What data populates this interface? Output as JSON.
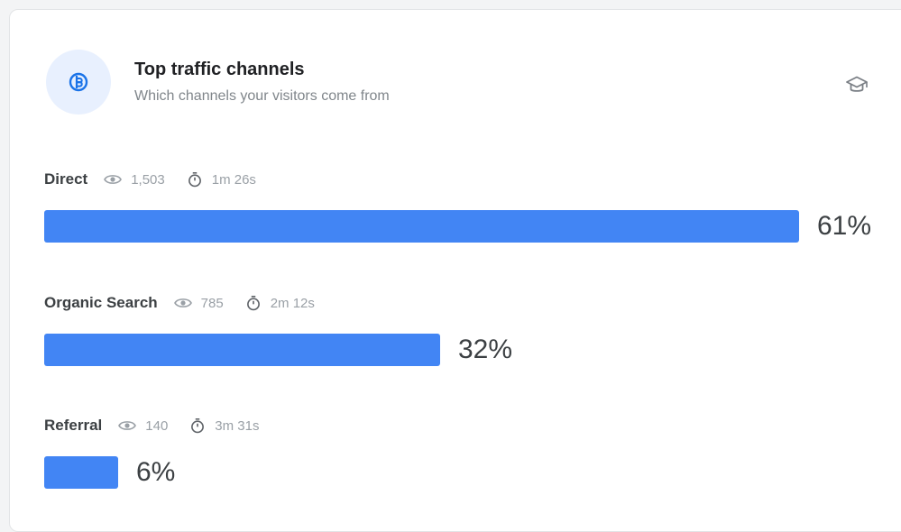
{
  "widget": {
    "title": "Top traffic channels",
    "subtitle": "Which channels your visitors come from",
    "header_icon": "channels-icon",
    "learn_icon": "graduation-cap-icon",
    "accent_color": "#4285f4"
  },
  "channels": [
    {
      "name": "Direct",
      "views": "1,503",
      "duration": "1m 26s",
      "percent_label": "61%",
      "percent": 61
    },
    {
      "name": "Organic Search",
      "views": "785",
      "duration": "2m 12s",
      "percent_label": "32%",
      "percent": 32
    },
    {
      "name": "Referral",
      "views": "140",
      "duration": "3m 31s",
      "percent_label": "6%",
      "percent": 6
    }
  ]
}
